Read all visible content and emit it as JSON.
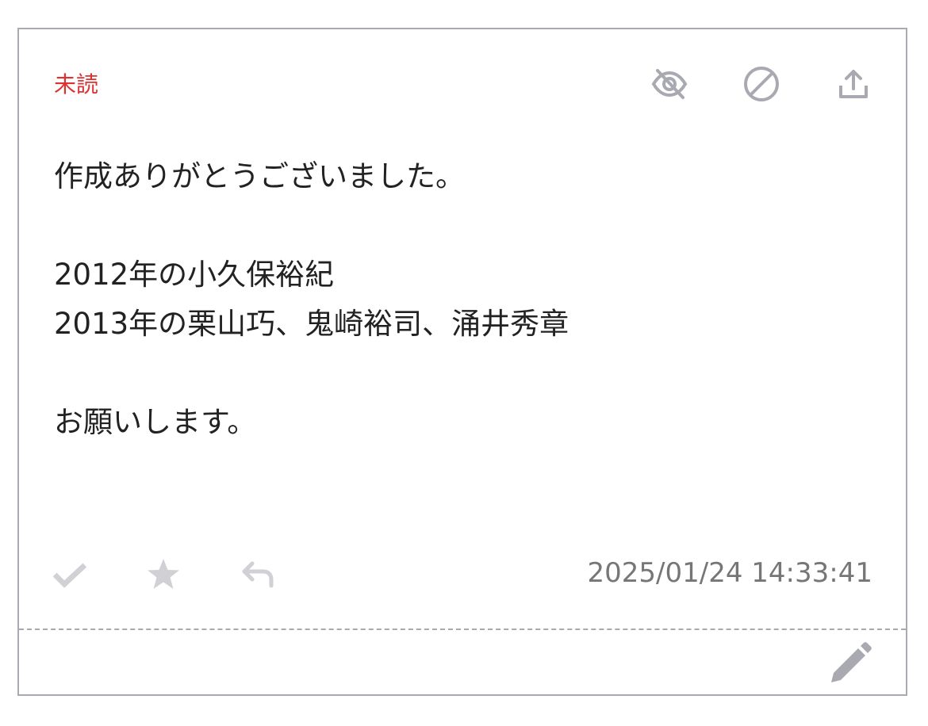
{
  "card": {
    "status_label": "未読",
    "status_color": "#e03030",
    "header_icons": [
      "eye-off-icon",
      "block-icon",
      "upload-icon"
    ],
    "message_lines": [
      "作成ありがとうございました。",
      "",
      "2012年の小久保裕紀",
      "2013年の栗山巧、鬼崎裕司、涌井秀章",
      "",
      "お願いします。"
    ],
    "footer_icons": [
      "check-icon",
      "star-icon",
      "reply-icon"
    ],
    "timestamp": "2025/01/24 14:33:41",
    "edit_icon": "pencil-icon"
  }
}
